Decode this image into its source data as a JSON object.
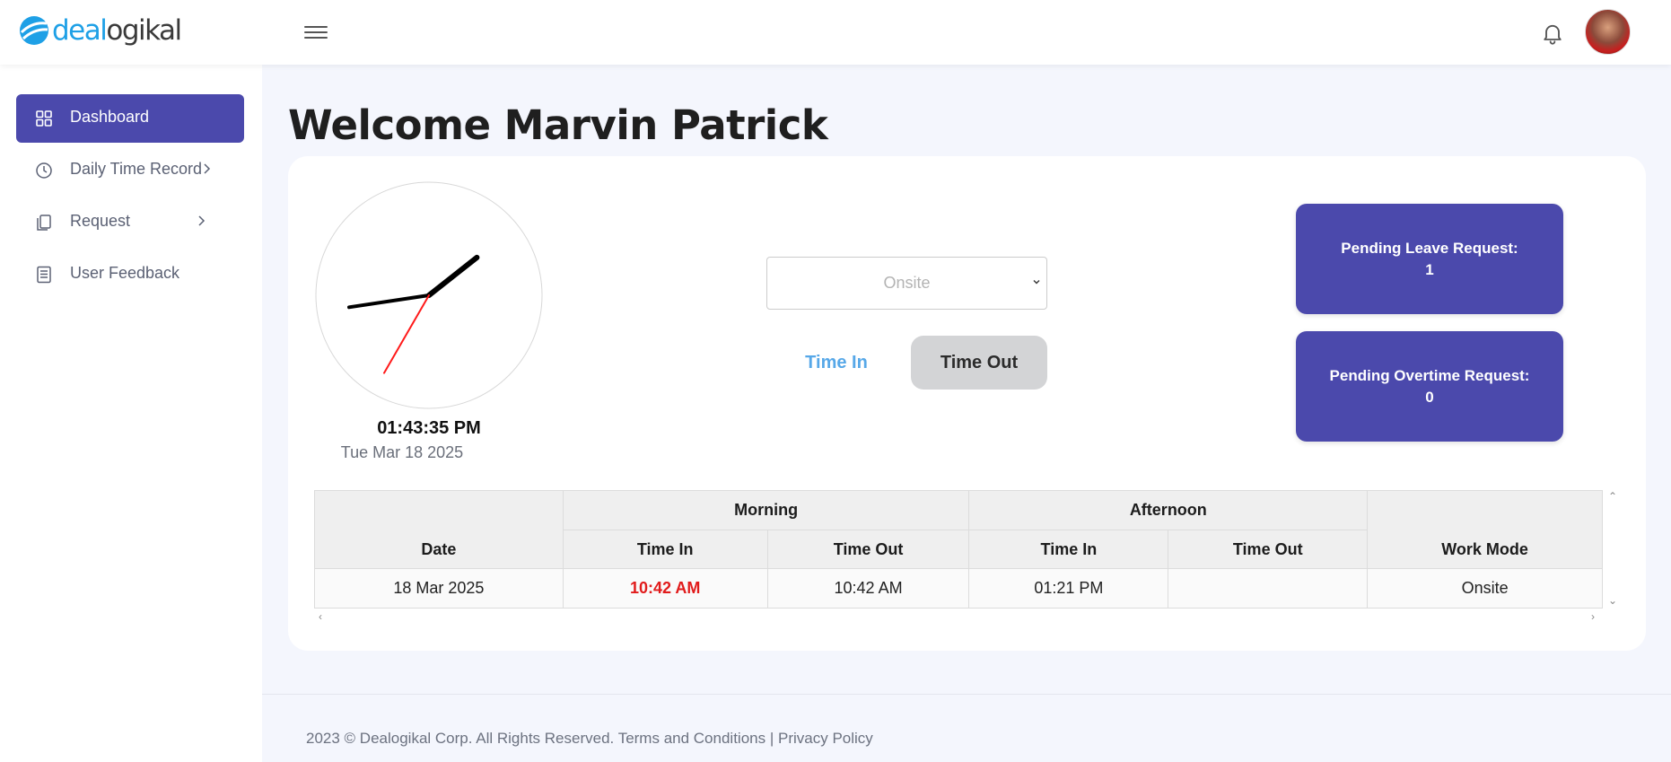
{
  "brand": {
    "part1": "deal",
    "part2": "ogikal",
    "accent": "#1ea0e6",
    "primary": "#4b49ac"
  },
  "header": {
    "menu_icon": "hamburger-icon",
    "notification_icon": "bell-icon",
    "avatar_alt": "user-avatar"
  },
  "sidebar": {
    "items": [
      {
        "label": "Dashboard",
        "icon": "grid-icon",
        "active": true
      },
      {
        "label": "Daily Time Record",
        "icon": "clock-icon",
        "has_submenu": true
      },
      {
        "label": "Request",
        "icon": "copy-icon",
        "has_submenu": true
      },
      {
        "label": "User Feedback",
        "icon": "document-icon"
      }
    ]
  },
  "main": {
    "welcome": "Welcome Marvin Patrick",
    "clock": {
      "time": "01:43:35 PM",
      "date": "Tue Mar 18 2025",
      "hour": 1,
      "minute": 43,
      "second": 35
    },
    "work_mode": {
      "selected": "Onsite"
    },
    "buttons": {
      "time_in": "Time In",
      "time_out": "Time Out"
    },
    "pending_leave": {
      "label": "Pending Leave Request:",
      "count": "1"
    },
    "pending_overtime": {
      "label": "Pending Overtime Request:",
      "count": "0"
    },
    "table": {
      "group_headers": {
        "morning": "Morning",
        "afternoon": "Afternoon"
      },
      "headers": {
        "date": "Date",
        "time_in": "Time In",
        "time_out": "Time Out",
        "work_mode": "Work Mode"
      },
      "rows": [
        {
          "date": "18 Mar 2025",
          "am_in": "10:42 AM",
          "am_out": "10:42 AM",
          "pm_in": "01:21 PM",
          "pm_out": "",
          "work_mode": "Onsite",
          "am_in_late": true
        }
      ]
    }
  },
  "footer": {
    "copyright": "2023 © Dealogikal Corp. All Rights Reserved.",
    "terms": "Terms and Conditions",
    "separator": "|",
    "privacy": "Privacy Policy"
  }
}
